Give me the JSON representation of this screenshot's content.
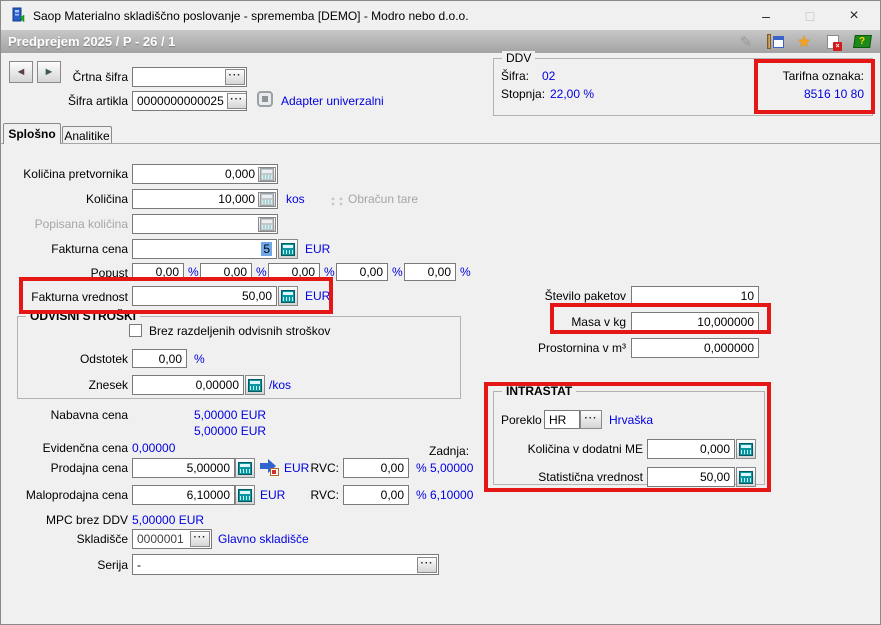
{
  "icons": {
    "minimize": "–",
    "maximize": "□",
    "close": "×",
    "pencil": "✎",
    "star": "★",
    "delete_x": "×",
    "help_question": "?",
    "nav_left": "◄",
    "nav_right": "►",
    "ellipsis": "···"
  },
  "colors": {
    "link_blue": "#0000e0",
    "highlight_red": "#e41616",
    "header_text": "#ffffff"
  },
  "window": {
    "title": "Saop Materialno skladiščno poslovanje - sprememba [DEMO] - Modro nebo d.o.o."
  },
  "header": {
    "title": "Predprejem 2025 / P - 26 / 1"
  },
  "top": {
    "crtna_sifra_label": "Črtna šifra",
    "crtna_sifra_value": "",
    "sifra_artikla_label": "Šifra artikla",
    "sifra_artikla_value": "0000000000025",
    "adapter_link": "Adapter univerzalni"
  },
  "ddv": {
    "group_label": "DDV",
    "sifra_label": "Šifra:",
    "sifra_value": "02",
    "stopnja_label": "Stopnja:",
    "stopnja_value": "22,00 %",
    "tarifna_label": "Tarifna oznaka:",
    "tarifna_value": "8516 10 80"
  },
  "tabs": {
    "splosno": "Splošno",
    "analitike": "Analitike"
  },
  "form": {
    "kolicina_pretvornika": {
      "label": "Količina pretvornika",
      "value": "0,000"
    },
    "kolicina": {
      "label": "Količina",
      "value": "10,000",
      "unit": "kos"
    },
    "obracun_tare": "Obračun tare",
    "popisana_kolicina": {
      "label": "Popisana količina",
      "value": ""
    },
    "fakturna_cena": {
      "label": "Fakturna cena",
      "value": "5",
      "unit": "EUR"
    },
    "popust": {
      "label": "Popust",
      "values": [
        "0,00",
        "0,00",
        "0,00",
        "0,00",
        "0,00"
      ],
      "unit": "%"
    },
    "fakturna_vrednost": {
      "label": "Fakturna vrednost",
      "value": "50,00",
      "unit": "EUR"
    },
    "odvisni_stroski": {
      "group_label": "ODVISNI STROŠKI",
      "checkbox_label": "Brez razdeljenih odvisnih stroškov",
      "checkbox_checked": false,
      "odstotek_label": "Odstotek",
      "odstotek_value": "0,00",
      "odstotek_unit": "%",
      "znesek_label": "Znesek",
      "znesek_value": "0,00000",
      "znesek_unit": "/kos"
    },
    "nabavna_cena": {
      "label": "Nabavna cena",
      "value1": "5,00000 EUR",
      "value2": "5,00000 EUR"
    },
    "evidencna_cena": {
      "label": "Evidenčna cena",
      "value": "0,00000"
    },
    "zadnja_label": "Zadnja:",
    "prodajna_cena": {
      "label": "Prodajna cena",
      "value": "5,00000",
      "unit": "EUR",
      "rvc_label": "RVC:",
      "rvc_value": "0,00",
      "zadnja_value": "% 5,00000"
    },
    "maloprodajna_cena": {
      "label": "Maloprodajna cena",
      "value": "6,10000",
      "unit": "EUR",
      "rvc_label": "RVC:",
      "rvc_value": "0,00",
      "zadnja_value": "% 6,10000"
    },
    "mpc_brez_ddv": {
      "label": "MPC brez DDV",
      "value": "5,00000 EUR"
    },
    "skladisce": {
      "label": "Skladišče",
      "value": "0000001",
      "link": "Glavno skladišče"
    },
    "serija": {
      "label": "Serija",
      "value": "-"
    }
  },
  "right": {
    "stevilo_paketov": {
      "label": "Število paketov",
      "value": "10"
    },
    "masa": {
      "label": "Masa v kg",
      "value": "10,000000"
    },
    "prostornina": {
      "label": "Prostornina v m³",
      "value": "0,000000"
    },
    "intrastat": {
      "group_label": "INTRASTAT",
      "poreklo_label": "Poreklo",
      "poreklo_value": "HR",
      "poreklo_country": "Hrvaška",
      "kolicina_me_label": "Količina v dodatni ME",
      "kolicina_me_value": "0,000",
      "statisticna_label": "Statistična vrednost",
      "statisticna_value": "50,00"
    }
  }
}
